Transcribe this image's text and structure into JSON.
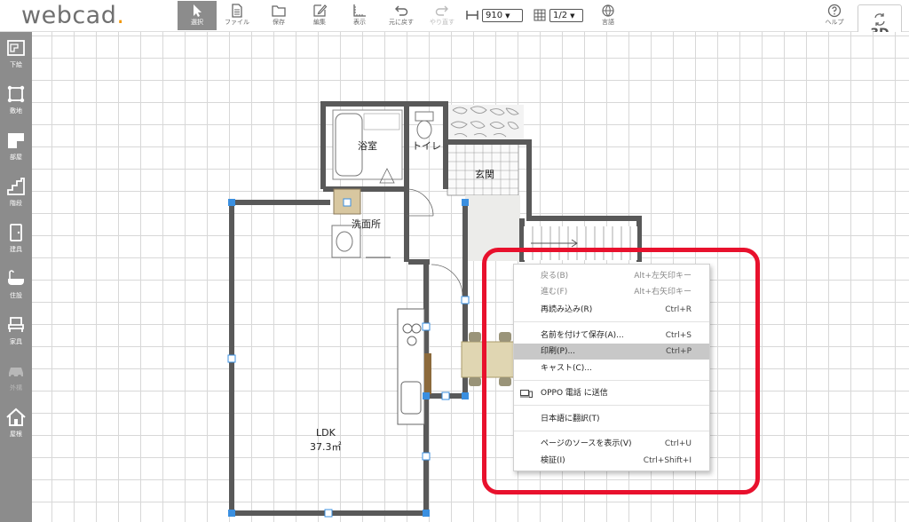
{
  "app": {
    "logo_main": "webcad",
    "logo_dot": "."
  },
  "toolbar": {
    "select": "選択",
    "file": "ファイル",
    "save": "保存",
    "edit": "編集",
    "view": "表示",
    "undo": "元に戻す",
    "redo": "やり直す",
    "wall_value": "910",
    "grid_value": "1/2",
    "language": "言語",
    "help": "ヘルプ",
    "btn3d": "3D"
  },
  "sidebar": {
    "items": [
      "下絵",
      "敷地",
      "部屋",
      "階段",
      "建具",
      "住設",
      "家具",
      "外構",
      "屋根"
    ]
  },
  "rooms": {
    "bath": "浴室",
    "toilet": "トイレ",
    "entrance": "玄関",
    "washroom": "洗面所",
    "ldk": "LDK",
    "ldk_area": "37.3㎡"
  },
  "context_menu": {
    "items": [
      {
        "label": "戻る(B)",
        "shortcut": "Alt+左矢印キー"
      },
      {
        "label": "進む(F)",
        "shortcut": "Alt+右矢印キー"
      },
      {
        "label": "再読み込み(R)",
        "shortcut": "Ctrl+R"
      },
      {
        "label": "名前を付けて保存(A)...",
        "shortcut": "Ctrl+S"
      },
      {
        "label": "印刷(P)...",
        "shortcut": "Ctrl+P"
      },
      {
        "label": "キャスト(C)...",
        "shortcut": ""
      },
      {
        "label": "OPPO 電話 に送信",
        "shortcut": ""
      },
      {
        "label": "日本語に翻訳(T)",
        "shortcut": ""
      },
      {
        "label": "ページのソースを表示(V)",
        "shortcut": "Ctrl+U"
      },
      {
        "label": "検証(I)",
        "shortcut": "Ctrl+Shift+I"
      }
    ]
  },
  "colors": {
    "sidebar": "#8c8c8c",
    "accent": "#f29600",
    "highlight": "#e8112d",
    "handle": "#3a8fe0"
  }
}
